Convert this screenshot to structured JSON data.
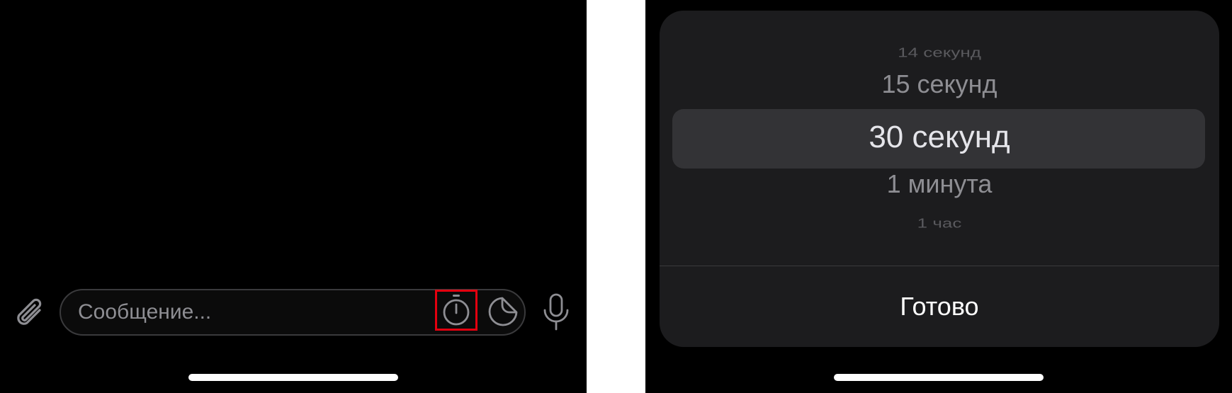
{
  "left_screen": {
    "composer": {
      "placeholder": "Сообщение...",
      "icons": {
        "attach": "paperclip-icon",
        "timer": "stopwatch-icon",
        "sticker": "sticker-icon",
        "voice": "microphone-icon"
      },
      "highlight_color": "#e3000f"
    }
  },
  "right_screen": {
    "timer_picker": {
      "items": [
        {
          "label": "14 секунд",
          "state": "far"
        },
        {
          "label": "15 секунд",
          "state": "near"
        },
        {
          "label": "30 секунд",
          "state": "selected"
        },
        {
          "label": "1 минута",
          "state": "near"
        },
        {
          "label": "1 час",
          "state": "far"
        }
      ],
      "selected_label": "30 секунд",
      "done_label": "Готово"
    }
  },
  "colors": {
    "background": "#000000",
    "sheet": "#1c1c1e",
    "picker_selection": "#333336",
    "text_primary": "#ffffff",
    "text_secondary": "#8e8e93"
  }
}
